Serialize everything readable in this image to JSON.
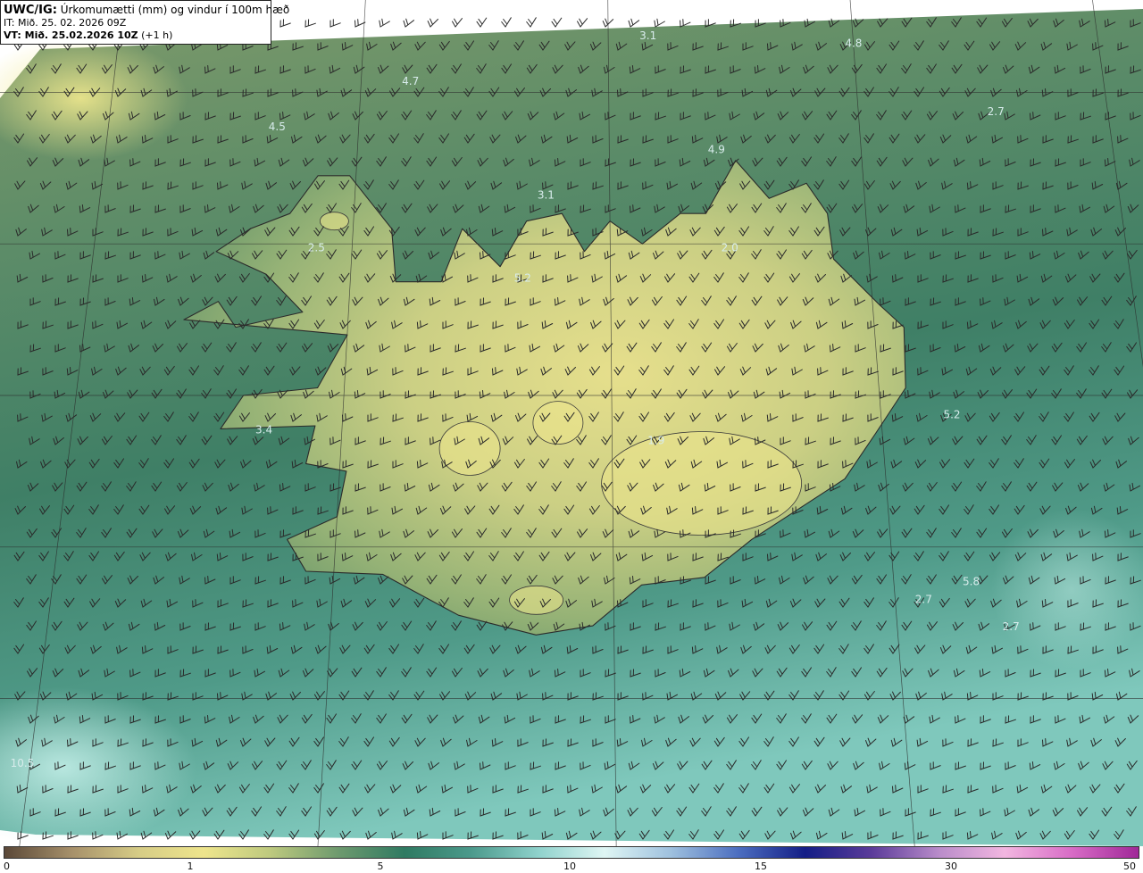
{
  "header": {
    "model": "UWC/IG:",
    "title": "Úrkomumætti (mm) og vindur í 100m hæð",
    "issue_time": "IT: Mið. 25. 02. 2026 09Z",
    "valid_time_bold": "VT: Mið. 25.02.2026 10Z",
    "valid_time_offset": "(+1 h)"
  },
  "map_labels": [
    {
      "text": "3.1",
      "lon": -17.35,
      "lat": 67.35
    },
    {
      "text": "4.8",
      "lon": -14.0,
      "lat": 67.3
    },
    {
      "text": "4.7",
      "lon": -21.2,
      "lat": 67.05
    },
    {
      "text": "2.7",
      "lon": -11.8,
      "lat": 66.85
    },
    {
      "text": "4.5",
      "lon": -23.3,
      "lat": 66.75
    },
    {
      "text": "4.9",
      "lon": -16.3,
      "lat": 66.6
    },
    {
      "text": "3.1",
      "lon": -19.0,
      "lat": 66.3
    },
    {
      "text": "2.5",
      "lon": -22.55,
      "lat": 65.95
    },
    {
      "text": "2.0",
      "lon": -16.15,
      "lat": 65.95
    },
    {
      "text": "5.2",
      "lon": -19.35,
      "lat": 65.75
    },
    {
      "text": "3.4",
      "lon": -23.15,
      "lat": 64.75
    },
    {
      "text": "5.2",
      "lon": -12.95,
      "lat": 64.85
    },
    {
      "text": "1.9",
      "lon": -17.35,
      "lat": 64.68
    },
    {
      "text": "5.8",
      "lon": -12.9,
      "lat": 63.75
    },
    {
      "text": "2.7",
      "lon": -13.6,
      "lat": 63.63
    },
    {
      "text": "2.7",
      "lon": -12.4,
      "lat": 63.45
    },
    {
      "text": "10.5",
      "lon": -26.1,
      "lat": 62.55
    }
  ],
  "colorbar": {
    "min": 0,
    "max": 50,
    "ticks": [
      "0",
      "1",
      "5",
      "10",
      "15",
      "30",
      "50"
    ],
    "colors": [
      "#5a4838",
      "#a6906a",
      "#d6cc86",
      "#eee58c",
      "#bdc97e",
      "#6e9a6e",
      "#2f7a62",
      "#4c9a8c",
      "#8fd2cc",
      "#dff6f4",
      "#9ec0de",
      "#4c6ec0",
      "#141e86",
      "#5c3c9a",
      "#b98cca",
      "#f2b6e0",
      "#d86cc6",
      "#a02898"
    ]
  },
  "map_extent": {
    "lon_min": -27.2,
    "lon_max": -10.0,
    "lat_min": 62.25,
    "lat_max": 67.55
  },
  "wind_field": {
    "u_knots": 10,
    "v_knots": -8
  }
}
